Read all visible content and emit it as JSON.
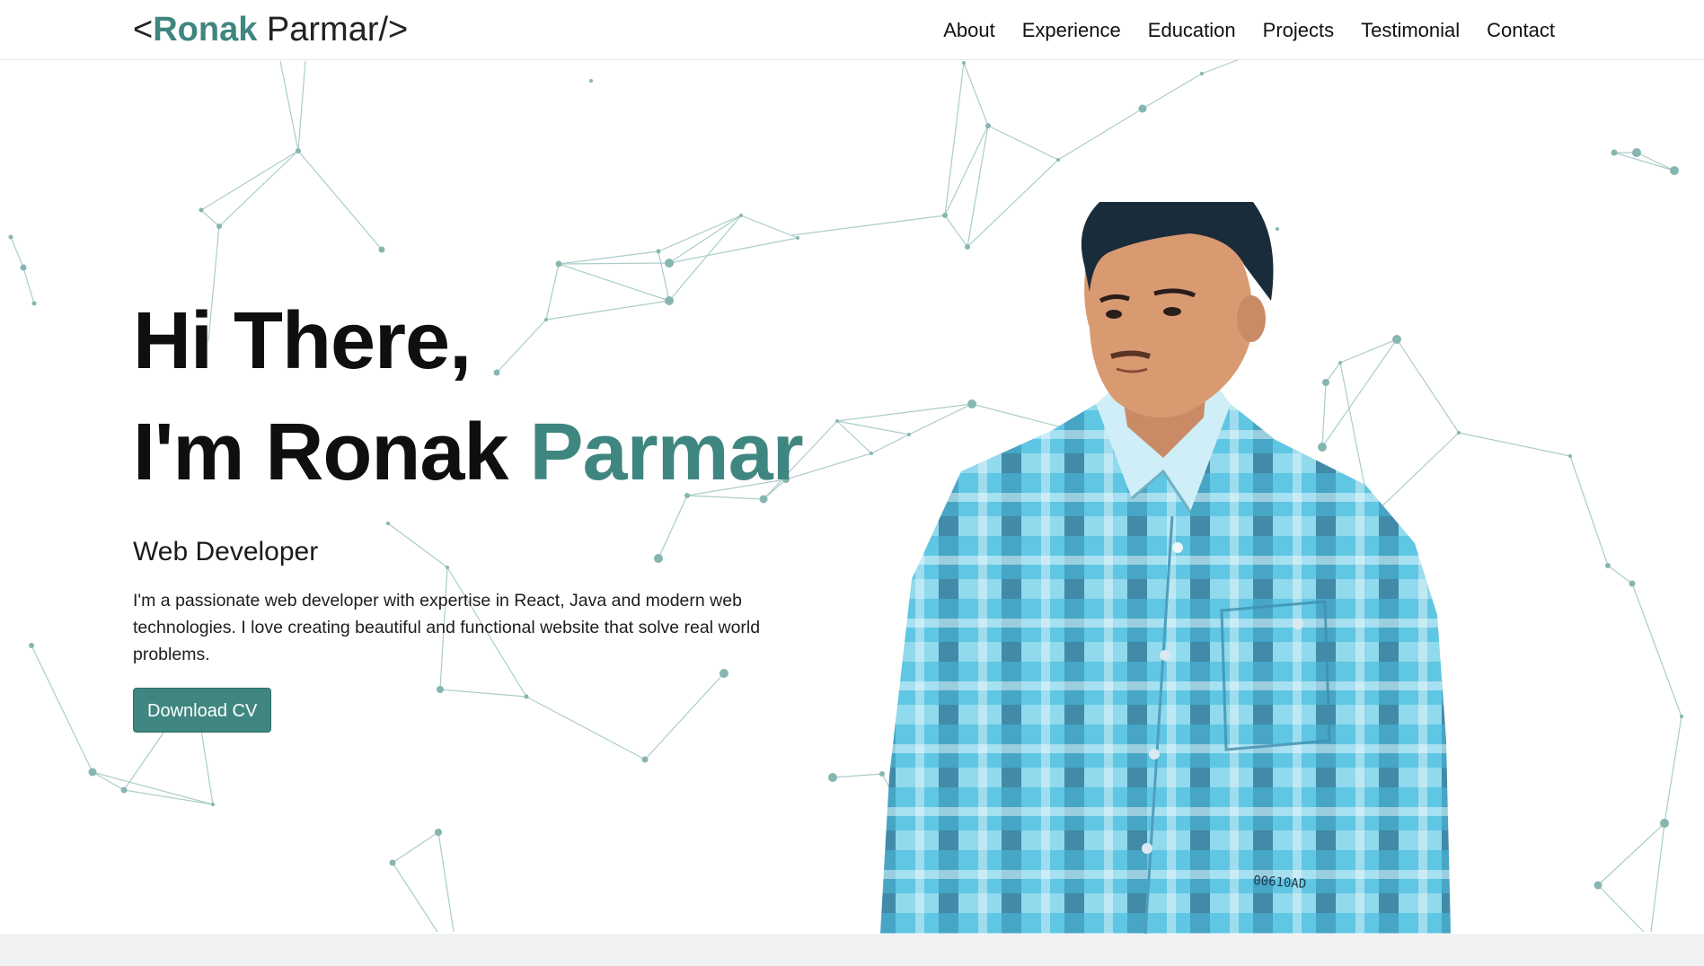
{
  "brand": {
    "open": "<",
    "first": "Ronak",
    "rest": " Parmar/>"
  },
  "nav": {
    "items": [
      "About",
      "Experience",
      "Education",
      "Projects",
      "Testimonial",
      "Contact"
    ]
  },
  "hero": {
    "line1": "Hi There,",
    "line2_prefix": "I'm Ronak ",
    "line2_accent": "Parmar",
    "role": "Web Developer",
    "description": "I'm a passionate web developer with expertise in React, Java and modern web technologies. I love creating beautiful and functional website that solve real world problems.",
    "button_label": "Download CV"
  },
  "portrait": {
    "shirt_label": "00610AD"
  },
  "colors": {
    "accent": "#3f8680",
    "network": "#7fb3ae"
  }
}
